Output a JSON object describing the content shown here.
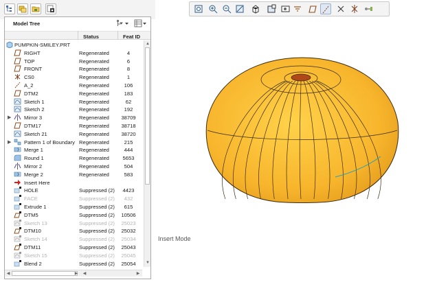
{
  "left_toolbar": {
    "icons": [
      "model-tree-icon",
      "layers-icon",
      "folder-icon",
      "settings-icon"
    ]
  },
  "tree": {
    "title": "Model Tree",
    "columns": {
      "status": "Status",
      "feat_id": "Feat ID"
    },
    "root": "PUMPKIN-SMILEY.PRT",
    "rows": [
      {
        "name": "RIGHT",
        "status": "Regenerated",
        "id": "4",
        "icon": "datum-plane-icon",
        "dim": false,
        "expander": ""
      },
      {
        "name": "TOP",
        "status": "Regenerated",
        "id": "6",
        "icon": "datum-plane-icon",
        "dim": false,
        "expander": ""
      },
      {
        "name": "FRONT",
        "status": "Regenerated",
        "id": "8",
        "icon": "datum-plane-icon",
        "dim": false,
        "expander": ""
      },
      {
        "name": "CS0",
        "status": "Regenerated",
        "id": "1",
        "icon": "coordinate-system-icon",
        "dim": false,
        "expander": ""
      },
      {
        "name": "A_2",
        "status": "Regenerated",
        "id": "106",
        "icon": "datum-axis-icon",
        "dim": false,
        "expander": ""
      },
      {
        "name": "DTM2",
        "status": "Regenerated",
        "id": "183",
        "icon": "datum-plane-icon",
        "dim": false,
        "expander": ""
      },
      {
        "name": "Sketch 1",
        "status": "Regenerated",
        "id": "62",
        "icon": "sketch-icon",
        "dim": false,
        "expander": ""
      },
      {
        "name": "Sketch 2",
        "status": "Regenerated",
        "id": "192",
        "icon": "sketch-icon",
        "dim": false,
        "expander": ""
      },
      {
        "name": "Mirror 3",
        "status": "Regenerated",
        "id": "38709",
        "icon": "mirror-icon",
        "dim": false,
        "expander": "▶"
      },
      {
        "name": "DTM17",
        "status": "Regenerated",
        "id": "38718",
        "icon": "datum-plane-icon",
        "dim": false,
        "expander": ""
      },
      {
        "name": "Sketch 21",
        "status": "Regenerated",
        "id": "38720",
        "icon": "sketch-icon",
        "dim": false,
        "expander": ""
      },
      {
        "name": "Pattern 1 of Boundary",
        "status": "Regenerated",
        "id": "215",
        "icon": "pattern-icon",
        "dim": false,
        "expander": "▶"
      },
      {
        "name": "Merge 1",
        "status": "Regenerated",
        "id": "444",
        "icon": "merge-icon",
        "dim": false,
        "expander": ""
      },
      {
        "name": "Round 1",
        "status": "Regenerated",
        "id": "5653",
        "icon": "round-icon",
        "dim": false,
        "expander": ""
      },
      {
        "name": "Mirror 2",
        "status": "Regenerated",
        "id": "504",
        "icon": "mirror-icon",
        "dim": false,
        "expander": ""
      },
      {
        "name": "Merge 2",
        "status": "Regenerated",
        "id": "583",
        "icon": "merge-icon",
        "dim": false,
        "expander": ""
      },
      {
        "name": "Insert Here",
        "status": "",
        "id": "",
        "icon": "insert-arrow-icon",
        "dim": false,
        "expander": ""
      },
      {
        "name": "HOLE",
        "status": "Suppressed (2)",
        "id": "4423",
        "icon": "suppressed-feature-icon",
        "dim": false,
        "expander": ""
      },
      {
        "name": "FACE",
        "status": "Suppressed (2)",
        "id": "432",
        "icon": "suppressed-feature-icon",
        "dim": true,
        "expander": ""
      },
      {
        "name": "Extrude 1",
        "status": "Suppressed (2)",
        "id": "615",
        "icon": "suppressed-feature-icon",
        "dim": false,
        "expander": ""
      },
      {
        "name": "DTM5",
        "status": "Suppressed (2)",
        "id": "10506",
        "icon": "suppressed-datum-icon",
        "dim": false,
        "expander": ""
      },
      {
        "name": "Sketch 13",
        "status": "Suppressed (2)",
        "id": "25023",
        "icon": "suppressed-sketch-icon",
        "dim": true,
        "expander": ""
      },
      {
        "name": "DTM10",
        "status": "Suppressed (2)",
        "id": "25032",
        "icon": "suppressed-datum-icon",
        "dim": false,
        "expander": ""
      },
      {
        "name": "Sketch 14",
        "status": "Suppressed (2)",
        "id": "25034",
        "icon": "suppressed-sketch-icon",
        "dim": true,
        "expander": ""
      },
      {
        "name": "DTM11",
        "status": "Suppressed (2)",
        "id": "25043",
        "icon": "suppressed-datum-icon",
        "dim": false,
        "expander": ""
      },
      {
        "name": "Sketch 15",
        "status": "Suppressed (2)",
        "id": "25045",
        "icon": "suppressed-sketch-icon",
        "dim": true,
        "expander": ""
      },
      {
        "name": "Blend 2",
        "status": "Suppressed (2)",
        "id": "25054",
        "icon": "suppressed-feature-icon",
        "dim": false,
        "expander": ""
      }
    ]
  },
  "graphics_toolbar": {
    "icons": [
      "refit-icon",
      "zoom-in-icon",
      "zoom-out-icon",
      "repaint-icon",
      "saved-orientations-icon",
      "display-style-icon",
      "view-manager-icon",
      "perspective-icon",
      "plane-display-icon",
      "axis-display-icon",
      "point-display-icon",
      "csys-display-icon",
      "annotation-display-icon"
    ],
    "active": "axis-display-icon"
  },
  "status": {
    "insert_mode": "Insert Mode"
  },
  "colors": {
    "pumpkin": "#f7b52c",
    "pumpkin_shadow": "#d98f1a",
    "stem": "#b04818",
    "edge": "#3a2a10"
  }
}
